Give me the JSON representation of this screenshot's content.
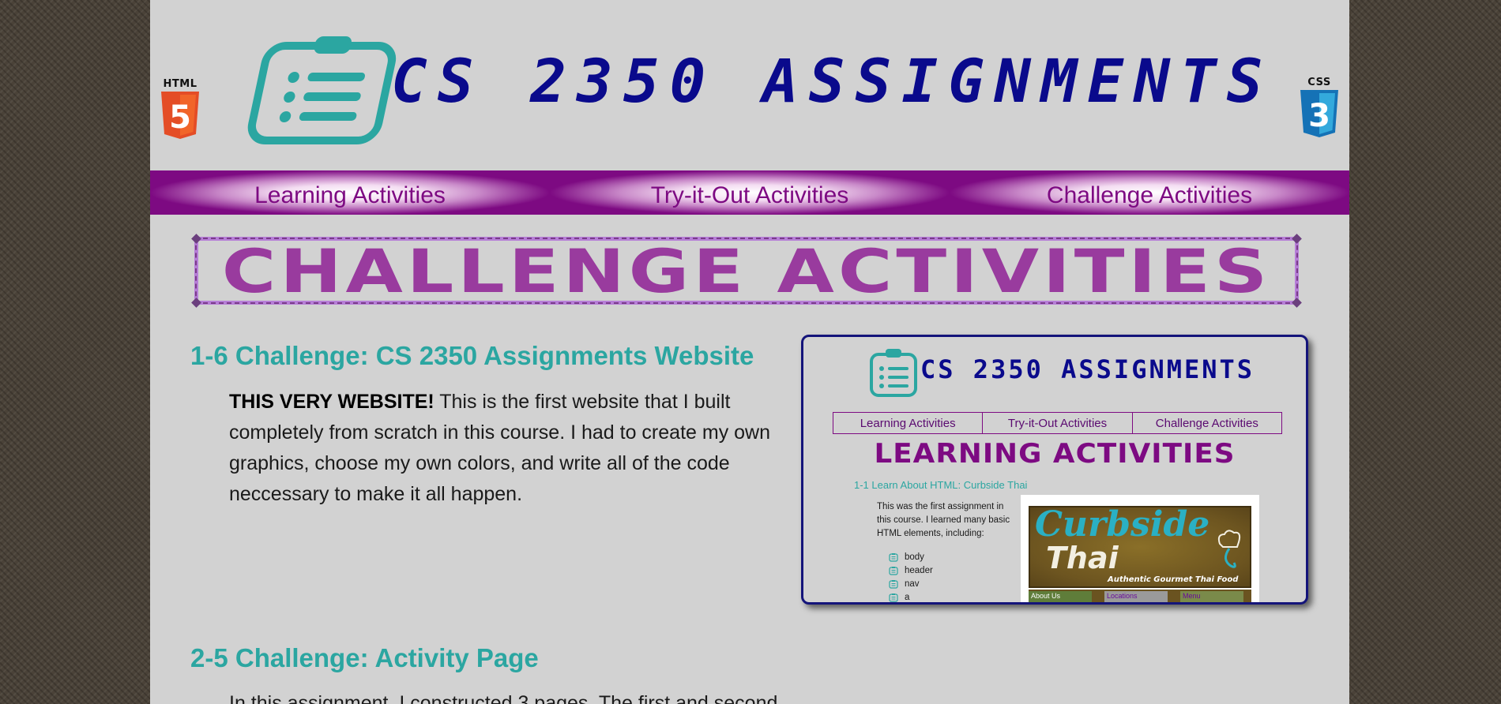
{
  "header": {
    "title": "CS 2350 ASSIGNMENTS",
    "html_badge": "HTML",
    "html_glyph": "5",
    "css_badge": "CSS",
    "css_glyph": "3",
    "logo_icon": "clipboard-list-icon"
  },
  "nav": {
    "items": [
      {
        "label": "Learning Activities"
      },
      {
        "label": "Try-it-Out Activities"
      },
      {
        "label": "Challenge Activities"
      }
    ]
  },
  "page": {
    "heading": "CHALLENGE ACTIVITIES"
  },
  "assignments": [
    {
      "title": "1-6 Challenge: CS 2350 Assignments Website",
      "desc_bold": "THIS VERY WEBSITE!",
      "desc_rest": " This is the first website that I built completely from scratch in this course. I had to create my own graphics, choose my own colors, and write all of the code neccessary to make it all happen."
    },
    {
      "title": "2-5 Challenge: Activity Page",
      "desc_rest": "In this assignment, I constructed 3 pages. The first and second"
    }
  ],
  "preview": {
    "title": "CS 2350 ASSIGNMENTS",
    "nav": [
      "Learning Activities",
      "Try-it-Out Activities",
      "Challenge Activities"
    ],
    "heading": "LEARNING ACTIVITIES",
    "item_title": "1-1 Learn About HTML: Curbside Thai",
    "item_desc": "This was the first assignment in this course. I learned many basic HTML elements, including:",
    "list": [
      "body",
      "header",
      "nav",
      "a"
    ],
    "curbside": {
      "word1": "Curbside",
      "word2": "Thai",
      "tagline": "Authentic Gourmet Thai Food",
      "tiles": [
        "About Us",
        "Locations",
        "Menu"
      ]
    }
  },
  "colors": {
    "title_blue": "#0a0a8c",
    "nav_purple": "#7d0a82",
    "heading_purple": "#993b9e",
    "teal": "#2ba6a1",
    "page_bg": "#d2d2d2"
  }
}
